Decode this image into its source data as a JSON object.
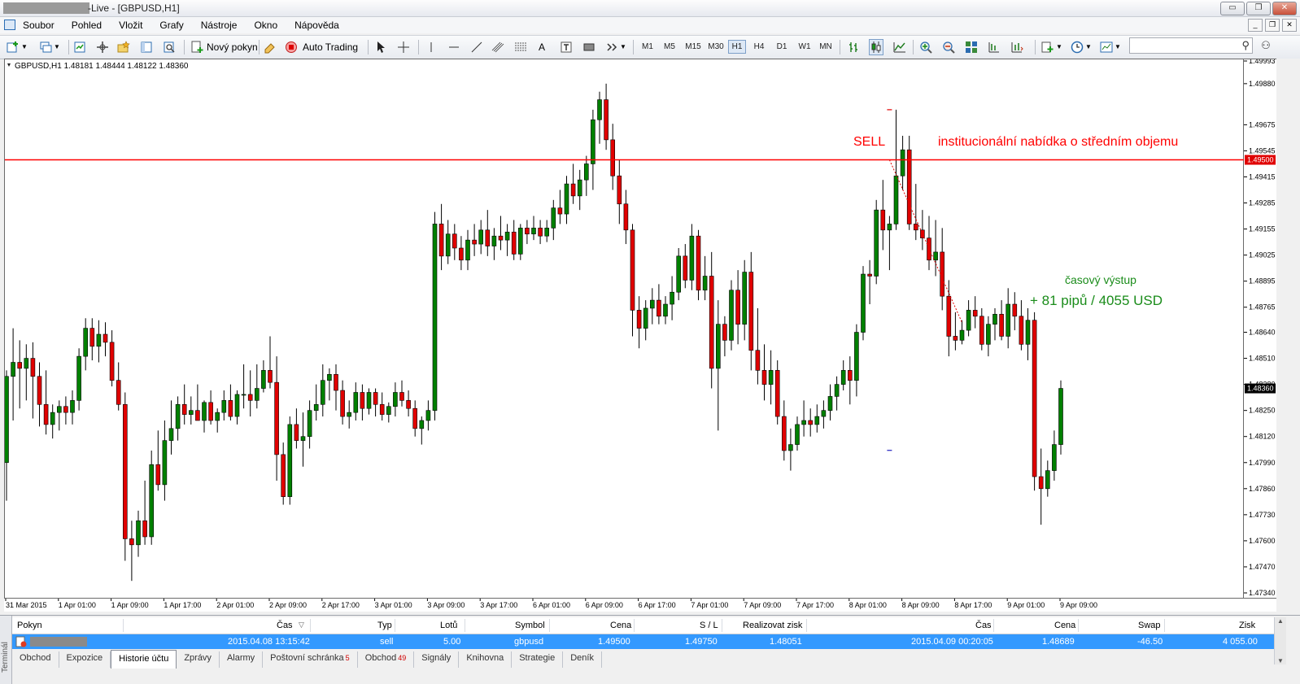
{
  "window": {
    "title": "-Live - [GBPUSD,H1]",
    "controls": [
      "▭",
      "❐",
      "✕"
    ],
    "mdi_controls": [
      "_",
      "❐",
      "✕"
    ]
  },
  "menu": [
    "Soubor",
    "Pohled",
    "Vložit",
    "Grafy",
    "Nástroje",
    "Okno",
    "Nápověda"
  ],
  "toolbar": {
    "new_order": "Nový pokyn",
    "auto_trading": "Auto Trading",
    "timeframes": [
      "M1",
      "M5",
      "M15",
      "M30",
      "H1",
      "H4",
      "D1",
      "W1",
      "MN"
    ],
    "active_timeframe": "H1",
    "search_icon": "search-icon"
  },
  "chart": {
    "header": "GBPUSD,H1  1.48181 1.48444 1.48122 1.48360",
    "sell_label": "SELL",
    "level_label": "institucionální nabídka o středním objemu",
    "exit_label": "časový výstup",
    "result_label": "+ 81 pipů / 4055 USD",
    "level_price": "1.49500",
    "current_price": "1.48360",
    "colors": {
      "bull": "#008000",
      "bear": "#e00000",
      "level": "#ff0000",
      "result": "#1a8c1a",
      "wick": "#000000"
    }
  },
  "chart_data": {
    "type": "candlestick",
    "symbol": "GBPUSD",
    "timeframe": "H1",
    "y_ticks": [
      "1.49993",
      "1.49880",
      "1.49675",
      "1.49545",
      "1.49415",
      "1.49285",
      "1.49155",
      "1.49025",
      "1.48895",
      "1.48765",
      "1.48640",
      "1.48510",
      "1.48380",
      "1.48250",
      "1.48120",
      "1.47990",
      "1.47860",
      "1.47730",
      "1.47600",
      "1.47470",
      "1.47340"
    ],
    "ylim": [
      1.4734,
      1.49993
    ],
    "x_ticks": [
      "31 Mar 2015",
      "1 Apr 01:00",
      "1 Apr 09:00",
      "1 Apr 17:00",
      "2 Apr 01:00",
      "2 Apr 09:00",
      "2 Apr 17:00",
      "3 Apr 01:00",
      "3 Apr 09:00",
      "3 Apr 17:00",
      "6 Apr 01:00",
      "6 Apr 09:00",
      "6 Apr 17:00",
      "7 Apr 01:00",
      "7 Apr 09:00",
      "7 Apr 17:00",
      "8 Apr 01:00",
      "8 Apr 09:00",
      "8 Apr 17:00",
      "9 Apr 01:00",
      "9 Apr 09:00"
    ],
    "horizontal_line": 1.495,
    "candles": [
      [
        1.4799,
        1.4845,
        1.478,
        1.4842
      ],
      [
        1.4842,
        1.4866,
        1.482,
        1.4849
      ],
      [
        1.4849,
        1.486,
        1.4826,
        1.4846
      ],
      [
        1.4846,
        1.4858,
        1.483,
        1.4851
      ],
      [
        1.4851,
        1.4859,
        1.4821,
        1.4842
      ],
      [
        1.4842,
        1.4849,
        1.4817,
        1.4828
      ],
      [
        1.4828,
        1.4845,
        1.4813,
        1.4818
      ],
      [
        1.4818,
        1.4828,
        1.4811,
        1.4824
      ],
      [
        1.4824,
        1.483,
        1.4815,
        1.4827
      ],
      [
        1.4827,
        1.4832,
        1.4818,
        1.4824
      ],
      [
        1.4824,
        1.4835,
        1.4818,
        1.483
      ],
      [
        1.483,
        1.4856,
        1.4825,
        1.4852
      ],
      [
        1.4852,
        1.4871,
        1.4845,
        1.4866
      ],
      [
        1.4866,
        1.4871,
        1.485,
        1.4857
      ],
      [
        1.4857,
        1.487,
        1.4849,
        1.4863
      ],
      [
        1.4863,
        1.4869,
        1.4852,
        1.4859
      ],
      [
        1.4859,
        1.4865,
        1.4837,
        1.484
      ],
      [
        1.484,
        1.4849,
        1.4825,
        1.4828
      ],
      [
        1.4828,
        1.4834,
        1.475,
        1.4761
      ],
      [
        1.4761,
        1.477,
        1.474,
        1.4758
      ],
      [
        1.4758,
        1.4775,
        1.4752,
        1.477
      ],
      [
        1.477,
        1.479,
        1.4758,
        1.4762
      ],
      [
        1.4762,
        1.4805,
        1.4758,
        1.4798
      ],
      [
        1.4798,
        1.4815,
        1.4785,
        1.4788
      ],
      [
        1.4788,
        1.482,
        1.478,
        1.481
      ],
      [
        1.481,
        1.483,
        1.4803,
        1.4816
      ],
      [
        1.4816,
        1.4832,
        1.481,
        1.4828
      ],
      [
        1.4828,
        1.4838,
        1.4818,
        1.4823
      ],
      [
        1.4823,
        1.4832,
        1.4818,
        1.4825
      ],
      [
        1.4825,
        1.4838,
        1.482,
        1.482
      ],
      [
        1.482,
        1.483,
        1.4814,
        1.4829
      ],
      [
        1.4829,
        1.4835,
        1.4818,
        1.482
      ],
      [
        1.482,
        1.4826,
        1.4814,
        1.4824
      ],
      [
        1.4824,
        1.4835,
        1.482,
        1.483
      ],
      [
        1.483,
        1.4838,
        1.482,
        1.4822
      ],
      [
        1.4822,
        1.4835,
        1.4818,
        1.4833
      ],
      [
        1.4833,
        1.4848,
        1.4826,
        1.4833
      ],
      [
        1.4833,
        1.4845,
        1.4822,
        1.483
      ],
      [
        1.483,
        1.4848,
        1.4826,
        1.4836
      ],
      [
        1.4836,
        1.485,
        1.4834,
        1.4845
      ],
      [
        1.4845,
        1.4862,
        1.4836,
        1.4839
      ],
      [
        1.4839,
        1.4852,
        1.479,
        1.4803
      ],
      [
        1.4803,
        1.4809,
        1.4778,
        1.4782
      ],
      [
        1.4782,
        1.4822,
        1.4778,
        1.4818
      ],
      [
        1.4818,
        1.4826,
        1.4806,
        1.481
      ],
      [
        1.481,
        1.4824,
        1.4797,
        1.4812
      ],
      [
        1.4812,
        1.483,
        1.4806,
        1.4825
      ],
      [
        1.4825,
        1.4838,
        1.482,
        1.4828
      ],
      [
        1.4828,
        1.4848,
        1.4822,
        1.484
      ],
      [
        1.484,
        1.4846,
        1.483,
        1.4843
      ],
      [
        1.4843,
        1.4848,
        1.4825,
        1.4835
      ],
      [
        1.4835,
        1.484,
        1.4818,
        1.4822
      ],
      [
        1.4822,
        1.483,
        1.4816,
        1.4824
      ],
      [
        1.4824,
        1.4839,
        1.482,
        1.4834
      ],
      [
        1.4834,
        1.4838,
        1.482,
        1.4826
      ],
      [
        1.4826,
        1.4836,
        1.4823,
        1.4834
      ],
      [
        1.4834,
        1.4836,
        1.4822,
        1.4828
      ],
      [
        1.4828,
        1.4834,
        1.482,
        1.4823
      ],
      [
        1.4823,
        1.4829,
        1.4819,
        1.4827
      ],
      [
        1.4827,
        1.4839,
        1.4822,
        1.4834
      ],
      [
        1.4834,
        1.484,
        1.4827,
        1.483
      ],
      [
        1.483,
        1.4835,
        1.4822,
        1.4826
      ],
      [
        1.4826,
        1.483,
        1.4812,
        1.4816
      ],
      [
        1.4816,
        1.4822,
        1.4808,
        1.482
      ],
      [
        1.482,
        1.483,
        1.4815,
        1.4825
      ],
      [
        1.4825,
        1.4924,
        1.482,
        1.4918
      ],
      [
        1.4918,
        1.4928,
        1.4895,
        1.4902
      ],
      [
        1.4902,
        1.492,
        1.4898,
        1.4913
      ],
      [
        1.4913,
        1.4918,
        1.49,
        1.4906
      ],
      [
        1.4906,
        1.4912,
        1.4895,
        1.49
      ],
      [
        1.49,
        1.4915,
        1.4895,
        1.491
      ],
      [
        1.491,
        1.4918,
        1.4902,
        1.4908
      ],
      [
        1.4908,
        1.492,
        1.4903,
        1.4915
      ],
      [
        1.4915,
        1.4925,
        1.4902,
        1.4907
      ],
      [
        1.4907,
        1.4916,
        1.49,
        1.4912
      ],
      [
        1.4912,
        1.4922,
        1.4905,
        1.491
      ],
      [
        1.491,
        1.4918,
        1.4902,
        1.4914
      ],
      [
        1.4914,
        1.492,
        1.49,
        1.4903
      ],
      [
        1.4903,
        1.4918,
        1.49,
        1.4916
      ],
      [
        1.4916,
        1.492,
        1.4908,
        1.4913
      ],
      [
        1.4913,
        1.4922,
        1.491,
        1.4916
      ],
      [
        1.4916,
        1.492,
        1.4908,
        1.4912
      ],
      [
        1.4912,
        1.492,
        1.4909,
        1.4916
      ],
      [
        1.4916,
        1.493,
        1.491,
        1.4926
      ],
      [
        1.4926,
        1.4935,
        1.4918,
        1.4923
      ],
      [
        1.4923,
        1.4942,
        1.4918,
        1.4938
      ],
      [
        1.4938,
        1.4948,
        1.4928,
        1.4932
      ],
      [
        1.4932,
        1.4945,
        1.4925,
        1.494
      ],
      [
        1.494,
        1.4952,
        1.4932,
        1.4948
      ],
      [
        1.4948,
        1.4975,
        1.4935,
        1.497
      ],
      [
        1.497,
        1.4984,
        1.4958,
        1.498
      ],
      [
        1.498,
        1.4988,
        1.4955,
        1.496
      ],
      [
        1.496,
        1.4968,
        1.4935,
        1.4942
      ],
      [
        1.4942,
        1.495,
        1.4918,
        1.4928
      ],
      [
        1.4928,
        1.4935,
        1.4908,
        1.4915
      ],
      [
        1.4915,
        1.4918,
        1.4862,
        1.4875
      ],
      [
        1.4875,
        1.4882,
        1.4856,
        1.4866
      ],
      [
        1.4866,
        1.488,
        1.486,
        1.4876
      ],
      [
        1.4876,
        1.4886,
        1.4868,
        1.488
      ],
      [
        1.488,
        1.4888,
        1.4868,
        1.4872
      ],
      [
        1.4872,
        1.4882,
        1.4868,
        1.4878
      ],
      [
        1.4878,
        1.4892,
        1.487,
        1.4884
      ],
      [
        1.4884,
        1.4906,
        1.488,
        1.4902
      ],
      [
        1.4902,
        1.4908,
        1.4886,
        1.489
      ],
      [
        1.489,
        1.4918,
        1.4885,
        1.4912
      ],
      [
        1.4912,
        1.4915,
        1.488,
        1.4885
      ],
      [
        1.4885,
        1.4902,
        1.488,
        1.4892
      ],
      [
        1.4892,
        1.4904,
        1.4836,
        1.4846
      ],
      [
        1.4846,
        1.488,
        1.4815,
        1.4868
      ],
      [
        1.4868,
        1.4872,
        1.4852,
        1.486
      ],
      [
        1.486,
        1.489,
        1.4855,
        1.4885
      ],
      [
        1.4885,
        1.4895,
        1.4858,
        1.4868
      ],
      [
        1.4868,
        1.49,
        1.486,
        1.4894
      ],
      [
        1.4894,
        1.4904,
        1.4845,
        1.4855
      ],
      [
        1.4855,
        1.4876,
        1.4838,
        1.4845
      ],
      [
        1.4845,
        1.4858,
        1.483,
        1.4838
      ],
      [
        1.4838,
        1.4855,
        1.4828,
        1.4845
      ],
      [
        1.4845,
        1.485,
        1.4818,
        1.4822
      ],
      [
        1.4822,
        1.483,
        1.48,
        1.4805
      ],
      [
        1.4805,
        1.4816,
        1.4795,
        1.4808
      ],
      [
        1.4808,
        1.4822,
        1.4805,
        1.4818
      ],
      [
        1.4818,
        1.483,
        1.4812,
        1.482
      ],
      [
        1.482,
        1.4826,
        1.4812,
        1.4818
      ],
      [
        1.4818,
        1.4828,
        1.4814,
        1.4822
      ],
      [
        1.4822,
        1.483,
        1.4816,
        1.4825
      ],
      [
        1.4825,
        1.4838,
        1.482,
        1.4832
      ],
      [
        1.4832,
        1.4842,
        1.4825,
        1.4838
      ],
      [
        1.4838,
        1.485,
        1.4835,
        1.4845
      ],
      [
        1.4845,
        1.4852,
        1.4828,
        1.484
      ],
      [
        1.484,
        1.4868,
        1.4832,
        1.4864
      ],
      [
        1.4864,
        1.4897,
        1.486,
        1.4893
      ],
      [
        1.4893,
        1.49,
        1.4878,
        1.4892
      ],
      [
        1.4892,
        1.493,
        1.4888,
        1.4925
      ],
      [
        1.4925,
        1.494,
        1.4905,
        1.4915
      ],
      [
        1.4915,
        1.4922,
        1.4895,
        1.4918
      ],
      [
        1.4918,
        1.4975,
        1.4915,
        1.4942
      ],
      [
        1.4942,
        1.4962,
        1.4935,
        1.4955
      ],
      [
        1.4955,
        1.4962,
        1.4915,
        1.4918
      ],
      [
        1.4918,
        1.4938,
        1.491,
        1.4915
      ],
      [
        1.4915,
        1.4925,
        1.4905,
        1.4911
      ],
      [
        1.4911,
        1.4922,
        1.4895,
        1.49
      ],
      [
        1.49,
        1.492,
        1.4892,
        1.4904
      ],
      [
        1.4904,
        1.4916,
        1.4875,
        1.4882
      ],
      [
        1.4882,
        1.489,
        1.4852,
        1.4862
      ],
      [
        1.4862,
        1.4874,
        1.4855,
        1.486
      ],
      [
        1.486,
        1.487,
        1.4858,
        1.4865
      ],
      [
        1.4865,
        1.488,
        1.4862,
        1.4875
      ],
      [
        1.4875,
        1.4882,
        1.4866,
        1.4872
      ],
      [
        1.4872,
        1.4876,
        1.4855,
        1.4858
      ],
      [
        1.4858,
        1.4872,
        1.4852,
        1.4868
      ],
      [
        1.4868,
        1.4876,
        1.486,
        1.4873
      ],
      [
        1.4873,
        1.488,
        1.486,
        1.4862
      ],
      [
        1.4862,
        1.4886,
        1.4856,
        1.4878
      ],
      [
        1.4878,
        1.4884,
        1.4865,
        1.4872
      ],
      [
        1.4872,
        1.488,
        1.4855,
        1.4858
      ],
      [
        1.4858,
        1.4876,
        1.485,
        1.487
      ],
      [
        1.487,
        1.4874,
        1.4785,
        1.4792
      ],
      [
        1.4792,
        1.4806,
        1.4768,
        1.4786
      ],
      [
        1.4786,
        1.48,
        1.4782,
        1.4795
      ],
      [
        1.4795,
        1.4815,
        1.479,
        1.4808
      ],
      [
        1.4808,
        1.484,
        1.4803,
        1.4836
      ]
    ]
  },
  "terminal": {
    "side_label": "Terminál",
    "headers": [
      "Pokyn",
      "Čas",
      "Typ",
      "Lotů",
      "Symbol",
      "Cena",
      "S / L",
      "Realizovat zisk",
      "Čas",
      "Cena",
      "Swap",
      "Zisk"
    ],
    "row": [
      "2015.04.08 13:15:42",
      "sell",
      "5.00",
      "gbpusd",
      "1.49500",
      "1.49750",
      "1.48051",
      "2015.04.09 00:20:05",
      "1.48689",
      "-46.50",
      "4 055.00"
    ],
    "tabs": [
      {
        "label": "Obchod",
        "badge": ""
      },
      {
        "label": "Expozice",
        "badge": ""
      },
      {
        "label": "Historie účtu",
        "badge": ""
      },
      {
        "label": "Zprávy",
        "badge": ""
      },
      {
        "label": "Alarmy",
        "badge": ""
      },
      {
        "label": "Poštovní schránka",
        "badge": "5"
      },
      {
        "label": "Obchod",
        "badge": "49"
      },
      {
        "label": "Signály",
        "badge": ""
      },
      {
        "label": "Knihovna",
        "badge": ""
      },
      {
        "label": "Strategie",
        "badge": ""
      },
      {
        "label": "Deník",
        "badge": ""
      }
    ],
    "active_tab": 2
  }
}
